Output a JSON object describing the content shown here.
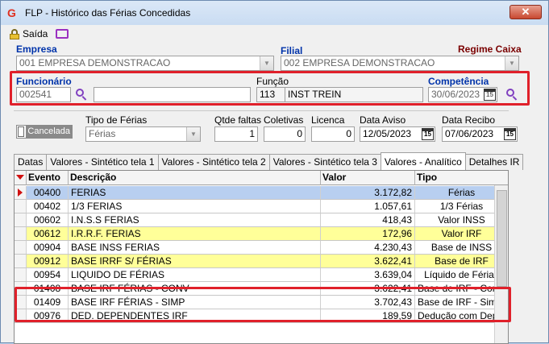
{
  "window": {
    "title": "FLP - Histórico das Férias Concedidas",
    "close_label": "✕"
  },
  "toolbar": {
    "exit_label": "Saída"
  },
  "header": {
    "empresa_label": "Empresa",
    "empresa_value": "001 EMPRESA DEMONSTRACAO",
    "filial_label": "Filial",
    "filial_value": "002 EMPRESA DEMONSTRACAO",
    "regime_label": "Regime Caixa",
    "funcionario_label": "Funcionário",
    "funcionario_code": "002541",
    "funcionario_name": "",
    "funcao_label": "Função",
    "funcao_code": "113",
    "funcao_name": "INST TREIN",
    "competencia_label": "Competência",
    "competencia_value": "30/06/2023"
  },
  "params": {
    "cancelada_label": "Cancelada",
    "tipo_ferias_label": "Tipo de Férias",
    "tipo_ferias_value": "Férias",
    "qtde_faltas_label": "Qtde faltas",
    "qtde_faltas_value": "1",
    "coletivas_label": "Coletivas",
    "coletivas_value": "0",
    "licenca_label": "Licenca",
    "licenca_value": "0",
    "data_aviso_label": "Data Aviso",
    "data_aviso_value": "12/05/2023",
    "data_recibo_label": "Data Recibo",
    "data_recibo_value": "07/06/2023"
  },
  "tabs": [
    {
      "label": "Datas"
    },
    {
      "label": "Valores - Sintético tela 1"
    },
    {
      "label": "Valores - Sintético tela 2"
    },
    {
      "label": "Valores - Sintético tela 3"
    },
    {
      "label": "Valores - Analítico"
    },
    {
      "label": "Detalhes IR"
    }
  ],
  "grid": {
    "columns": [
      "Evento",
      "Descrição",
      "Valor",
      "Tipo"
    ],
    "rows": [
      {
        "evento": "00400",
        "descricao": "FERIAS",
        "valor": "3.172,82",
        "tipo": "Férias",
        "bg": "#b8cff0"
      },
      {
        "evento": "00402",
        "descricao": "1/3 FERIAS",
        "valor": "1.057,61",
        "tipo": "1/3 Férias",
        "bg": "#ffffff"
      },
      {
        "evento": "00602",
        "descricao": "I.N.S.S FERIAS",
        "valor": "418,43",
        "tipo": "Valor INSS",
        "bg": "#ffffff"
      },
      {
        "evento": "00612",
        "descricao": "I.R.R.F. FERIAS",
        "valor": "172,96",
        "tipo": "Valor IRF",
        "bg": "#ffff99"
      },
      {
        "evento": "00904",
        "descricao": "BASE INSS FERIAS",
        "valor": "4.230,43",
        "tipo": "Base de INSS",
        "bg": "#ffffff"
      },
      {
        "evento": "00912",
        "descricao": "BASE IRRF S/ FÉRIAS",
        "valor": "3.622,41",
        "tipo": "Base de IRF",
        "bg": "#ffff99"
      },
      {
        "evento": "00954",
        "descricao": "LIQUIDO DE FÉRIAS",
        "valor": "3.639,04",
        "tipo": "Líquido de Férias",
        "bg": "#ffffff"
      },
      {
        "evento": "01408",
        "descricao": "BASE IRF FÉRIAS - CONV",
        "valor": "3.622,41",
        "tipo": "Base de IRF - Convencional",
        "bg": "#ffffff"
      },
      {
        "evento": "01409",
        "descricao": "BASE IRF FÉRIAS - SIMP",
        "valor": "3.702,43",
        "tipo": "Base de IRF - Simplificado",
        "bg": "#ffffff"
      },
      {
        "evento": "00976",
        "descricao": "DED. DEPENDENTES IRF",
        "valor": "189,59",
        "tipo": "Dedução com Dependentes",
        "bg": "#ffffff"
      }
    ]
  }
}
